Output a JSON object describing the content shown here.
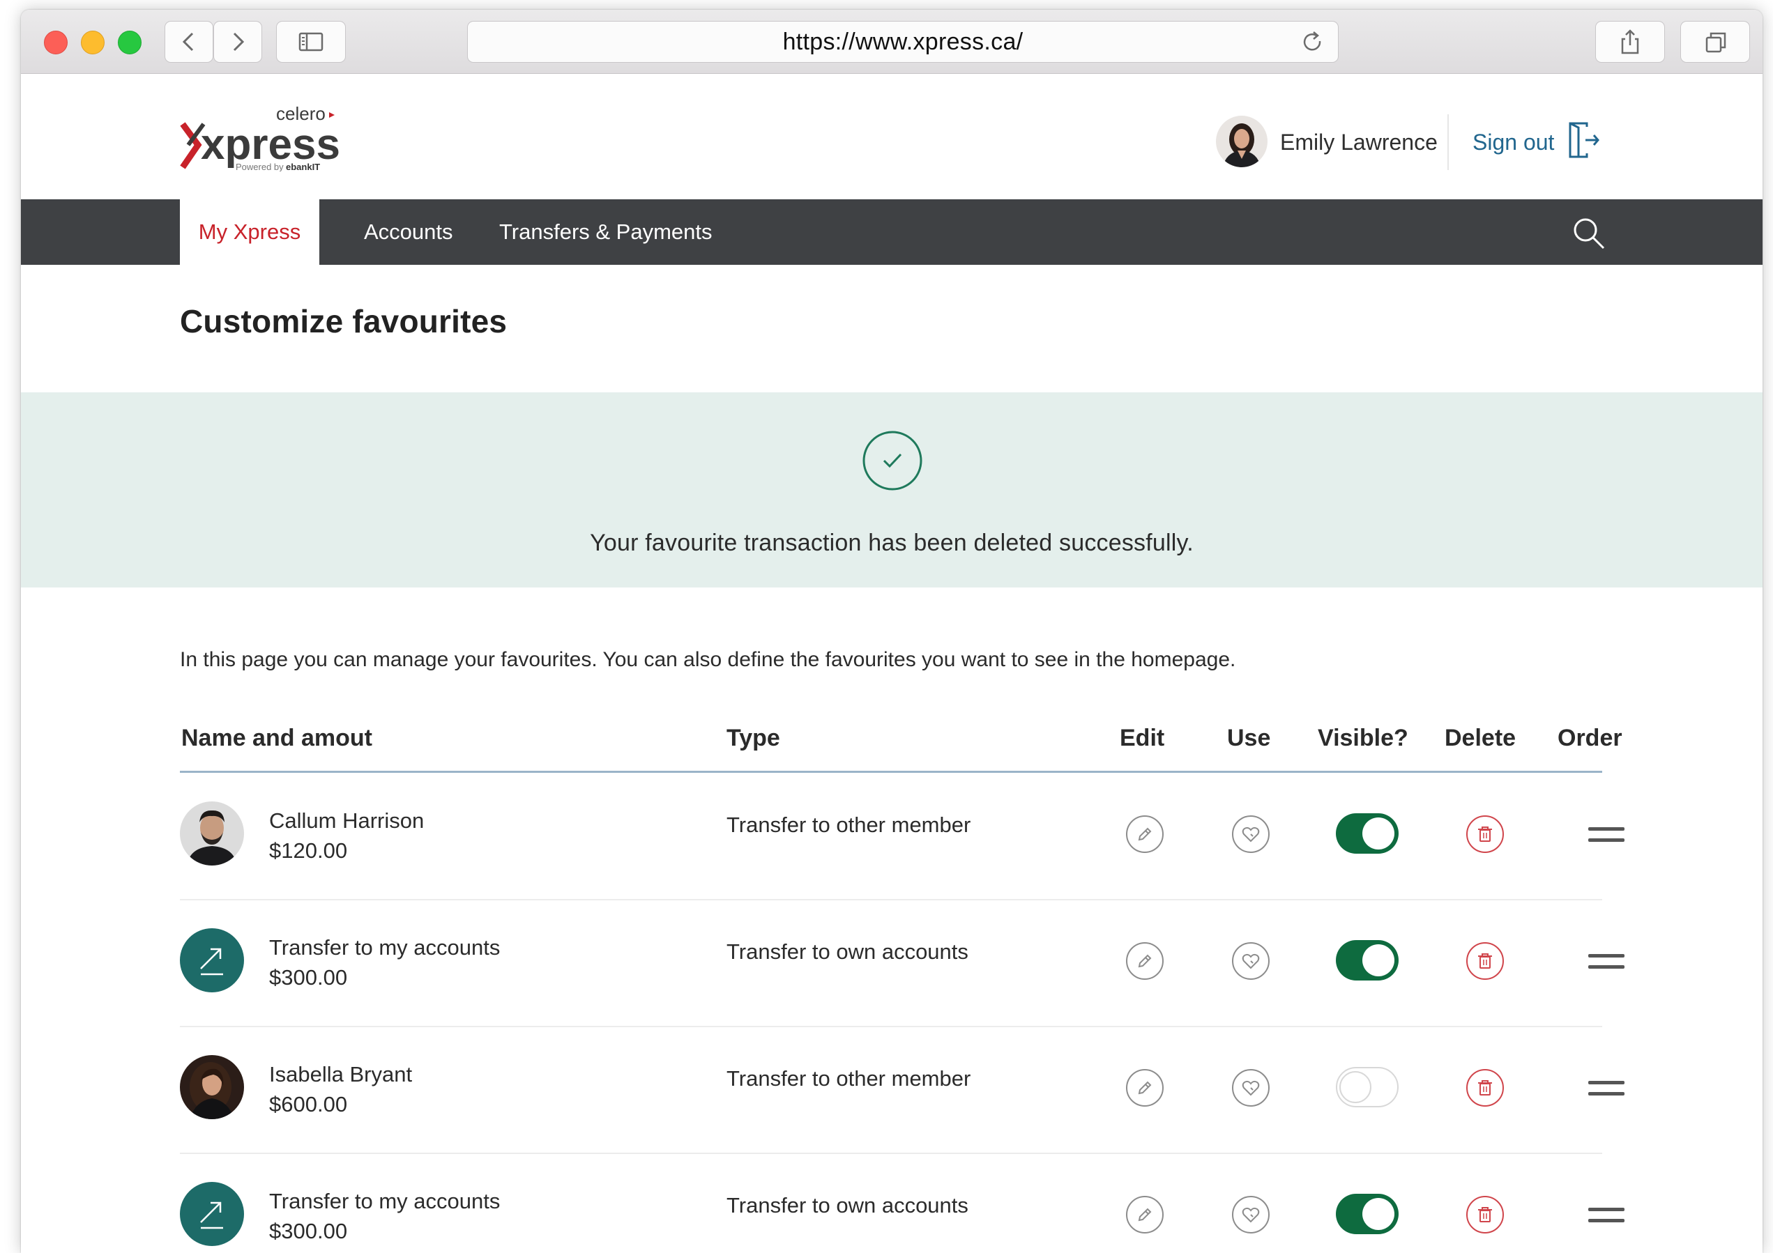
{
  "browser": {
    "url": "https://www.xpress.ca/"
  },
  "site": {
    "logo": {
      "brand_top": "celero",
      "brand_main": "xpress",
      "tagline_prefix": "Powered by",
      "tagline_brand": "ebankIT"
    },
    "user_name": "Emily Lawrence",
    "sign_out_label": "Sign out"
  },
  "nav": {
    "items": [
      {
        "label": "My Xpress",
        "active": true
      },
      {
        "label": "Accounts",
        "active": false
      },
      {
        "label": "Transfers & Payments",
        "active": false
      }
    ]
  },
  "page": {
    "title": "Customize favourites",
    "banner_message": "Your favourite transaction has been deleted successfully.",
    "intro": "In this page you can manage your favourites. You can also define the favourites you want to see in the homepage."
  },
  "table": {
    "headers": {
      "name": "Name and amout",
      "type": "Type",
      "edit": "Edit",
      "use": "Use",
      "visible": "Visible?",
      "delete": "Delete",
      "order": "Order"
    },
    "rows": [
      {
        "icon": "person-avatar",
        "name": "Callum Harrison",
        "amount": "$120.00",
        "type": "Transfer to other member",
        "visible": true
      },
      {
        "icon": "transfer-arrow-icon",
        "name": "Transfer to my accounts",
        "amount": "$300.00",
        "type": "Transfer to own accounts",
        "visible": true
      },
      {
        "icon": "person-avatar",
        "name": "Isabella Bryant",
        "amount": "$600.00",
        "type": "Transfer to other member",
        "visible": false
      },
      {
        "icon": "transfer-arrow-icon",
        "name": "Transfer to my accounts",
        "amount": "$300.00",
        "type": "Transfer to own accounts",
        "visible": true
      }
    ]
  },
  "colors": {
    "brand_red": "#c8222a",
    "nav_bg": "#3f4144",
    "banner_bg": "#e4efec",
    "success_green": "#1f7a5c",
    "toggle_on": "#0e6b3f",
    "link_blue": "#21668e",
    "transfer_icon_bg": "#1d6b68"
  }
}
